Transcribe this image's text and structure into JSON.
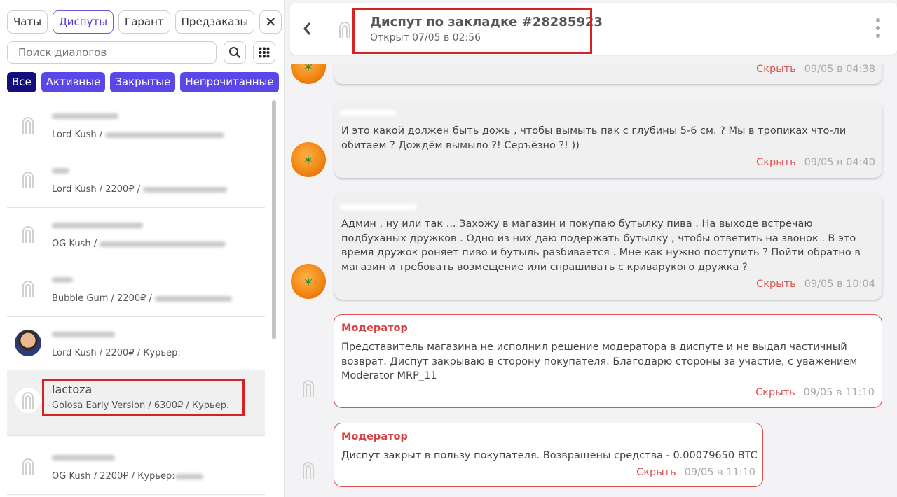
{
  "tabs": [
    {
      "label": "Чаты",
      "active": false
    },
    {
      "label": "Диспуты",
      "active": true
    },
    {
      "label": "Гарант",
      "active": false
    },
    {
      "label": "Предзаказы",
      "active": false
    }
  ],
  "close_label": "✕",
  "search": {
    "placeholder": "Поиск диалогов"
  },
  "filters": [
    {
      "label": "Все",
      "selected": true
    },
    {
      "label": "Активные",
      "selected": false
    },
    {
      "label": "Закрытые",
      "selected": false
    },
    {
      "label": "Непрочитанные",
      "selected": false
    }
  ],
  "dialogs": [
    {
      "name": "",
      "sub": "Lord Kush / ",
      "avatar": "logo"
    },
    {
      "name": "",
      "sub": "Lord Kush / 2200₽ / ",
      "avatar": "logo"
    },
    {
      "name": "",
      "sub": "OG Kush / ",
      "avatar": "logo"
    },
    {
      "name": "",
      "sub": "Bubble Gum / 2200₽ / ",
      "avatar": "logo"
    },
    {
      "name": "",
      "sub": "Lord Kush / 2200₽ / Курьер:",
      "avatar": "photo"
    },
    {
      "name": "lactoza",
      "sub": "Golosa Early Version / 6300₽ / Курьер.",
      "avatar": "logo",
      "selected": true
    },
    {
      "name": "",
      "sub": "OG Kush / 2200₽ / Курьер:",
      "avatar": "logo"
    }
  ],
  "header": {
    "title": "Диспут по закладке #28285923",
    "subtitle": "Открыт 07/05 в 02:56"
  },
  "messages": [
    {
      "kind": "user",
      "text": "",
      "hide": "Скрыть",
      "time": "09/05 в 04:38"
    },
    {
      "kind": "user",
      "text": "И это какой должен быть дожь , чтобы вымыть пак с глубины 5-6 см. ? Мы в тропиках что-ли обитаем ? Дождём вымыло ?! Серъёзно ?! ))",
      "hide": "Скрыть",
      "time": "09/05 в 04:40"
    },
    {
      "kind": "user",
      "text": "Админ , ну или так ... Захожу в магазин и покупаю бутылку пива . На выходе встречаю подбуханых дружков . Одно из них даю подержать бутылку , чтобы ответить на звонок . В это время дружок роняет пиво и бутыль разбивается . Мне как нужно поступить ? Пойти обратно в магазин и требовать возмещение или спрашивать с криварукого дружка ?",
      "hide": "Скрыть",
      "time": "09/05 в 10:04"
    },
    {
      "kind": "moderator",
      "author": "Модератор",
      "text": "Представитель магазина не исполнил решение модератора в диспуте и не выдал частичный возврат. Диспут закрываю в сторону покупателя. Благодарю стороны за участие, с уважением Moderator MRP_11",
      "hide": "Скрыть",
      "time": "09/05 в 11:10"
    },
    {
      "kind": "moderator",
      "author": "Модератор",
      "text": "Диспут закрыт в пользу покупателя. Возвращены средства - 0.00079650 BTC",
      "hide": "Скрыть",
      "time": "09/05 в 11:10"
    }
  ]
}
